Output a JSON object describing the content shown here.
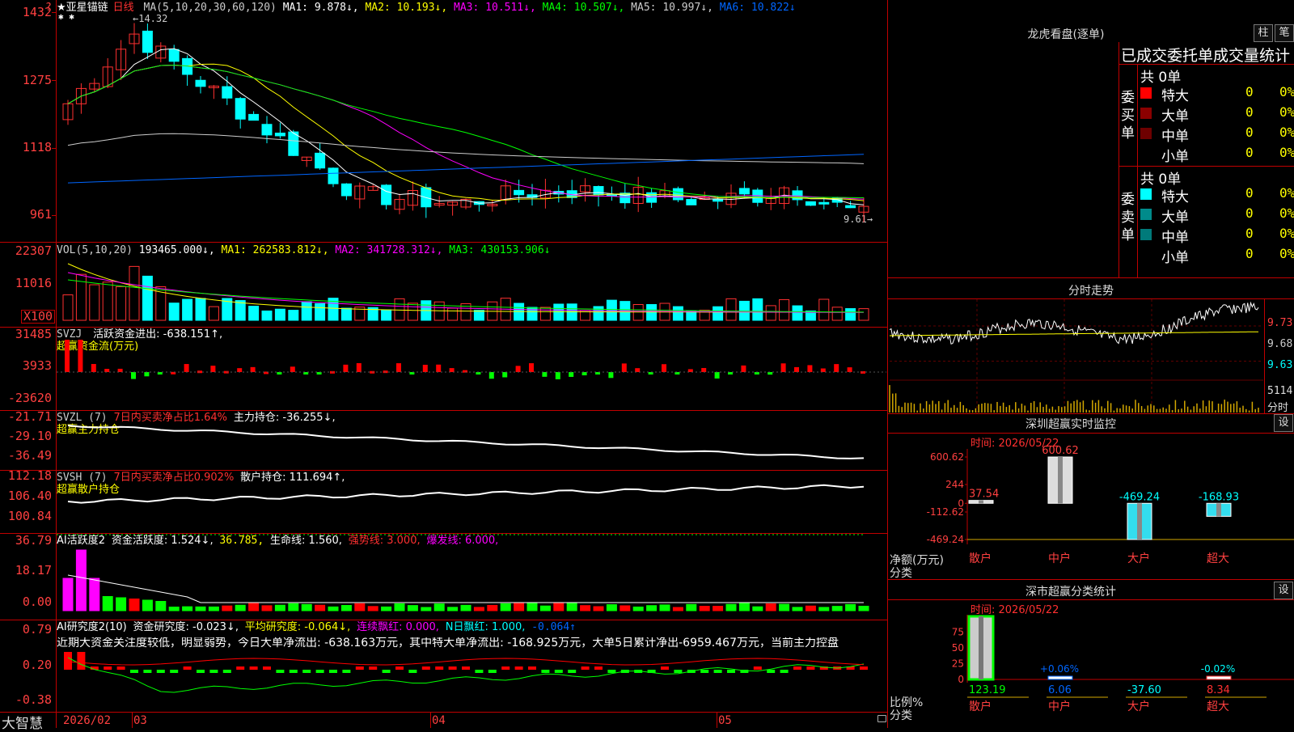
{
  "left_axis": {
    "price": [
      "1432",
      "1275",
      "1118",
      "961"
    ],
    "vol": [
      "22307",
      "11016",
      "X100"
    ],
    "svzj": [
      "31485",
      "3933",
      "-23620"
    ],
    "svzl": [
      "-21.71",
      "-29.10",
      "-36.49"
    ],
    "svsh": [
      "112.18",
      "106.40",
      "100.84"
    ],
    "ai1": [
      "36.79",
      "18.17",
      "0.00"
    ],
    "ai2": [
      "0.79",
      "0.20",
      "-0.38"
    ]
  },
  "main": {
    "corner_mark": "?",
    "stock_name": "★亚星锚链",
    "period": "日线",
    "ma_label": "MA(5,10,20,30,60,120)",
    "ma_values": [
      {
        "text": "MA1: 9.878↓,",
        "color": "#ffffff"
      },
      {
        "text": "MA2: 10.193↓,",
        "color": "#ffff00"
      },
      {
        "text": "MA3: 10.511↓,",
        "color": "#ff00ff"
      },
      {
        "text": "MA4: 10.507↓,",
        "color": "#00ff00"
      },
      {
        "text": "MA5: 10.997↓,",
        "color": "#cccccc"
      },
      {
        "text": "MA6: 10.822↓",
        "color": "#0066ff"
      }
    ],
    "high_mark": "←14.32",
    "low_mark": "9.61→",
    "stars": "✱ ✱"
  },
  "vol": {
    "label": "VOL(5,10,20)",
    "value": "193465.000↓,",
    "ma1": "MA1: 262583.812↓,",
    "ma2": "MA2: 341728.312↓,",
    "ma3": "MA3: 430153.906↓"
  },
  "svzj": {
    "label": "SVZJ",
    "text": "活跃资金进出: -638.151↑,",
    "sub": "超赢资金流(万元)"
  },
  "svzl": {
    "label": "SVZL (7)",
    "text1": "7日内买卖净占比1.64%",
    "text2": "主力持仓: -36.255↓,",
    "sub": "超赢主力持仓"
  },
  "svsh": {
    "label": "SVSH (7)",
    "text1": "7日内买卖净占比0.902%",
    "text2": "散户持仓: 111.694↑,",
    "sub": "超赢散户持仓"
  },
  "ai1": {
    "label": "AI活跃度2",
    "t1": "资金活跃度: 1.524↓,",
    "t2": "36.785,",
    "t3": "生命线: 1.560,",
    "t4": "强势线: 3.000,",
    "t5": "爆发线: 6.000,"
  },
  "ai2": {
    "label": "AI研究度2(10)",
    "t1": "资金研究度: -0.023↓,",
    "t2": "平均研究度: -0.064↓,",
    "t3": "连续飘红: 0.000,",
    "t4": "N日飘红: 1.000,",
    "t5": "-0.064↑",
    "commentary": "近期大资金关注度较低，明显弱势，今日大单净流出: -638.163万元，其中特大单净流出: -168.925万元，大单5日累计净出-6959.467万元，当前主力控盘"
  },
  "bottom": {
    "brand": "大智慧",
    "date1": "2026/02",
    "m03": "03",
    "m04": "04",
    "m05": "05"
  },
  "longhu": {
    "title": "龙虎看盘(逐单)",
    "btn_bar": "柱",
    "btn_pen": "笔",
    "header": "已成交委托单成交量统计",
    "buy_label": "委买单",
    "sell_label": "委卖单",
    "buy_total": "共 0单",
    "sell_total": "共 0单",
    "buy_rows": [
      {
        "name": "特大",
        "count": "0",
        "pct": "0%",
        "color": "#ff0000"
      },
      {
        "name": "大单",
        "count": "0",
        "pct": "0%",
        "color": "#8b0000"
      },
      {
        "name": "中单",
        "count": "0",
        "pct": "0%",
        "color": "#6e0000"
      },
      {
        "name": "小单",
        "count": "0",
        "pct": "0%",
        "color": ""
      }
    ],
    "sell_rows": [
      {
        "name": "特大",
        "count": "0",
        "pct": "0%",
        "color": "#00ffff"
      },
      {
        "name": "大单",
        "count": "0",
        "pct": "0%",
        "color": "#008b8b"
      },
      {
        "name": "中单",
        "count": "0",
        "pct": "0%",
        "color": "#007a7a"
      },
      {
        "name": "小单",
        "count": "0",
        "pct": "0%",
        "color": ""
      }
    ]
  },
  "intraday": {
    "title": "分时走势",
    "p1": "9.73",
    "p2": "9.68",
    "p3": "9.63",
    "vol": "5114",
    "unit": "分时"
  },
  "monitor": {
    "title": "深圳超赢实时监控",
    "set": "设",
    "date_label": "时间: 2026/05/22",
    "yticks": [
      "600.62",
      "244",
      "0",
      "-112.62",
      "-469.24"
    ],
    "ylabel": "净额(万元)",
    "cat_label": "分类",
    "chart_data": {
      "type": "bar",
      "categories": [
        "散户",
        "中户",
        "大户",
        "超大"
      ],
      "values": [
        37.54,
        600.62,
        -469.24,
        -168.93
      ],
      "value_labels": [
        "37.54",
        "600.62",
        "-469.24",
        "-168.93"
      ],
      "ylim": [
        -469.24,
        600.62
      ]
    }
  },
  "classify": {
    "title": "深市超赢分类统计",
    "set": "设",
    "date_label": "时间: 2026/05/22",
    "yticks": [
      "75",
      "50",
      "25",
      "0"
    ],
    "ylabel": "比例%",
    "cat_label": "分类",
    "chart_data": {
      "type": "bar",
      "categories": [
        "散户",
        "中户",
        "大户",
        "超大"
      ],
      "values": [
        123.19,
        6.06,
        -37.6,
        8.34
      ],
      "value_labels": [
        "123.19",
        "6.06",
        "-37.60",
        "8.34"
      ],
      "bar_pcts": [
        100,
        0.06,
        0,
        -0.02
      ],
      "bar_pct_labels": [
        "",
        "+0.06%",
        "",
        "-0.02%"
      ],
      "ylim": [
        0,
        100
      ]
    }
  }
}
